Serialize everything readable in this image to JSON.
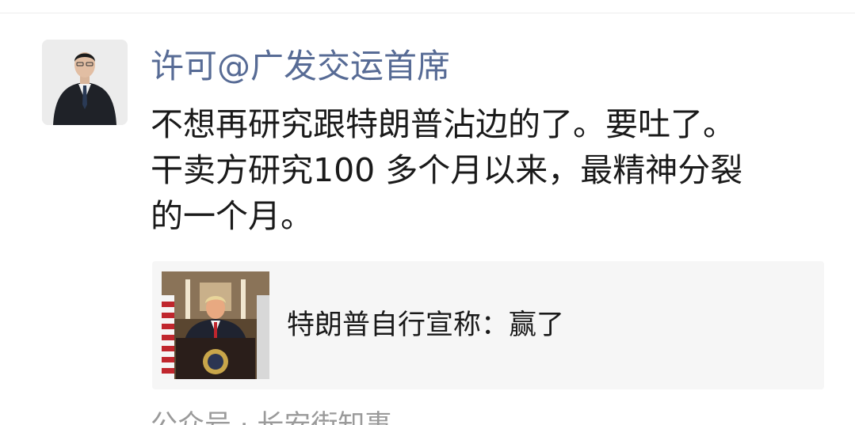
{
  "post": {
    "author": "许可@广发交运首席",
    "text_lines": [
      "不想再研究跟特朗普沾边的了。要吐了。",
      "干卖方研究100 多个月以来，最精神分裂",
      "的一个月。"
    ]
  },
  "link_card": {
    "title": "特朗普自行宣称：赢了"
  },
  "source": {
    "label": "公众号 · 长安街知事"
  },
  "colors": {
    "author_name": "#576b95",
    "card_background": "#f6f6f6",
    "source_text": "#9a9a9a"
  }
}
